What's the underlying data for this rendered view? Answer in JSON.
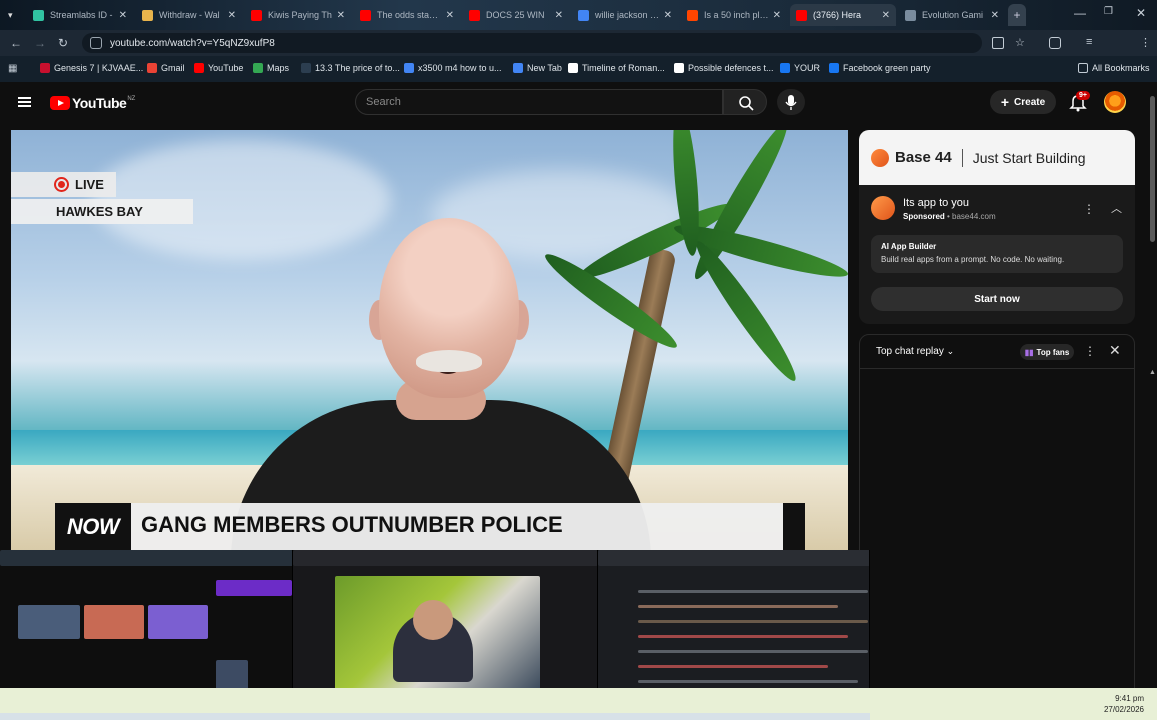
{
  "browser": {
    "tabs": [
      {
        "label": "Streamlabs ID -",
        "favicon_color": "#31c3a2",
        "active": false
      },
      {
        "label": "Withdraw - Wal",
        "favicon_color": "#e8b44c",
        "active": false
      },
      {
        "label": "Kiwis Paying Th",
        "favicon_color": "#ff0000",
        "active": false
      },
      {
        "label": "The odds stacke",
        "favicon_color": "#ff0000",
        "active": false
      },
      {
        "label": "DOCS 25 WIN",
        "favicon_color": "#ff0000",
        "active": false
      },
      {
        "label": "willie jackson ag",
        "favicon_color": "#4285f4",
        "active": false
      },
      {
        "label": "Is a 50 inch plas",
        "favicon_color": "#ff4500",
        "active": false
      },
      {
        "label": "(3766) Hera",
        "favicon_color": "#ff0000",
        "active": true
      },
      {
        "label": "Evolution Gami",
        "favicon_color": "#7a8c9e",
        "active": false
      }
    ],
    "url": "youtube.com/watch?v=Y5qNZ9xufP8",
    "bookmarks": [
      {
        "label": "Genesis 7 | KJVAAE...",
        "color": "#c8102e"
      },
      {
        "label": "Gmail",
        "color": "#ea4335"
      },
      {
        "label": "YouTube",
        "color": "#ff0000"
      },
      {
        "label": "Maps",
        "color": "#34a853"
      },
      {
        "label": "13.3 The price of to...",
        "color": "#2c3e50"
      },
      {
        "label": "x3500 m4 how to u...",
        "color": "#4285f4"
      },
      {
        "label": "New Tab",
        "color": "#4285f4"
      },
      {
        "label": "Timeline of Roman...",
        "color": "#ffffff"
      },
      {
        "label": "Possible defences t...",
        "color": "#ffffff"
      },
      {
        "label": "YOUR",
        "color": "#1877f2"
      },
      {
        "label": "Facebook green party",
        "color": "#1877f2"
      }
    ],
    "all_bookmarks_label": "All Bookmarks"
  },
  "youtube": {
    "logo_text": "YouTube",
    "country_code": "NZ",
    "search_placeholder": "Search",
    "create_label": "Create",
    "notification_count": "9+"
  },
  "video": {
    "live_label": "LIVE",
    "region": "HAWKES BAY",
    "now_label": "NOW",
    "headline": "GANG MEMBERS OUTNUMBER POLICE"
  },
  "ad": {
    "brand": "Base 44",
    "tagline": "Just Start Building",
    "title": "Its app to you",
    "sponsored": "Sponsored",
    "domain": "base44.com",
    "box_heading": "AI App Builder",
    "box_text": "Build real apps from a prompt. No code. No waiting.",
    "cta": "Start now"
  },
  "chat": {
    "title": "Top chat replay",
    "fans_label": "Top fans"
  },
  "taskbar": {
    "time": "9:41 pm",
    "date": "27/02/2026"
  }
}
